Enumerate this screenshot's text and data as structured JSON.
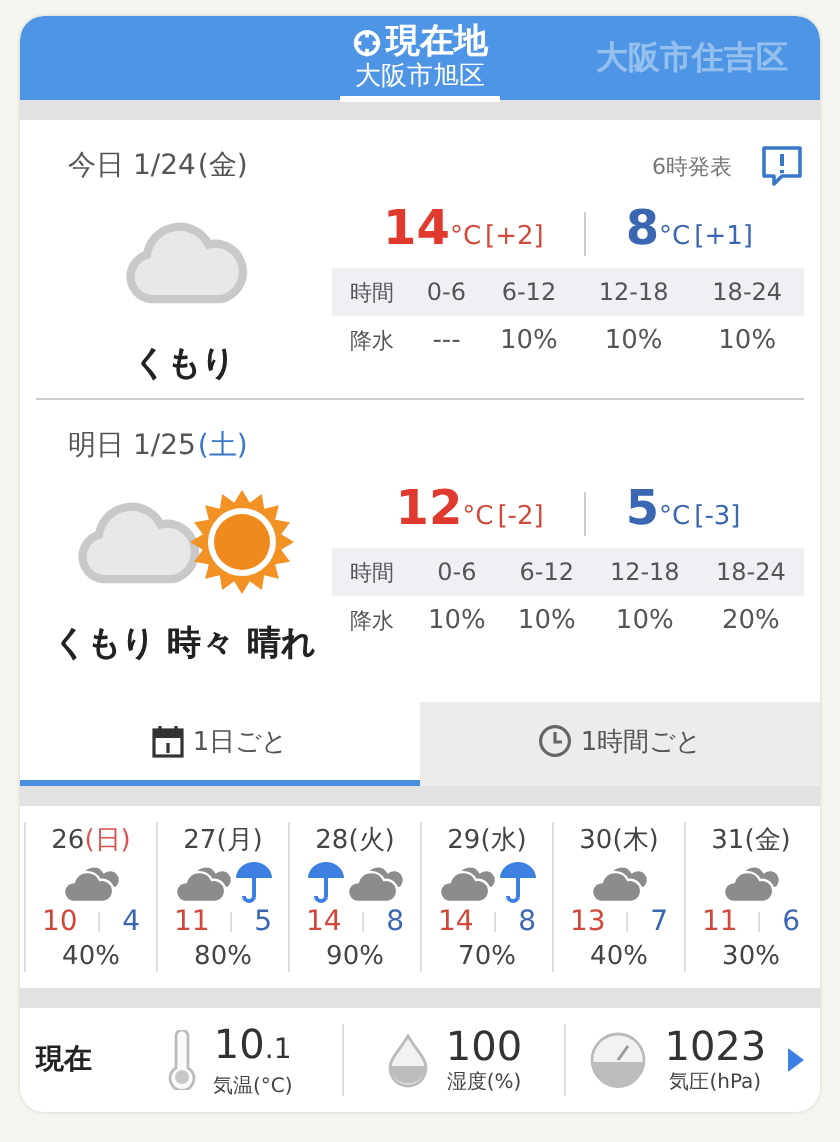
{
  "locations": [
    {
      "name": "現在地",
      "area": "大阪市旭区",
      "selected": true,
      "kind": "gps"
    },
    {
      "name": "大阪市住吉区",
      "selected": false,
      "kind": "city"
    }
  ],
  "days": [
    {
      "date": "今日 1/24",
      "weekday": "(金)",
      "color": "#555555",
      "issued": "6時発表",
      "weather": "くもり",
      "kind": "cloud",
      "high": "14",
      "high_unit": "°C",
      "high_diff": "[+2]",
      "low": "8",
      "low_unit": "°C",
      "low_diff": "[+1]",
      "hours": [
        "時間",
        "0-6",
        "6-12",
        "12-18",
        "18-24"
      ],
      "rain": [
        "降水",
        "---",
        "10%",
        "10%",
        "10%"
      ]
    },
    {
      "date": "明日 1/25",
      "weekday": "(土)",
      "color": "#3a78c9",
      "weather": "くもり 時々 晴れ",
      "kind": "cloud_sun",
      "high": "12",
      "high_unit": "°C",
      "high_diff": "[-2]",
      "low": "5",
      "low_unit": "°C",
      "low_diff": "[-3]",
      "hours": [
        "時間",
        "0-6",
        "6-12",
        "12-18",
        "18-24"
      ],
      "rain": [
        "降水",
        "10%",
        "10%",
        "10%",
        "20%"
      ]
    }
  ],
  "mode_tabs": [
    {
      "label": "1日ごと",
      "kind": "calendar",
      "selected": true
    },
    {
      "label": "1時間ごと",
      "kind": "clock",
      "selected": false
    }
  ],
  "week": [
    {
      "date": "26",
      "weekday": "(日)",
      "color": "#d9534f",
      "kind": "cloud",
      "high": "10",
      "low": "4",
      "rain": "40%"
    },
    {
      "date": "27",
      "weekday": "(月)",
      "color": "#444444",
      "kind": "cloud_rain",
      "high": "11",
      "low": "5",
      "rain": "80%"
    },
    {
      "date": "28",
      "weekday": "(火)",
      "color": "#444444",
      "kind": "rain_cloud",
      "high": "14",
      "low": "8",
      "rain": "90%"
    },
    {
      "date": "29",
      "weekday": "(水)",
      "color": "#444444",
      "kind": "cloud_rain",
      "high": "14",
      "low": "8",
      "rain": "70%"
    },
    {
      "date": "30",
      "weekday": "(木)",
      "color": "#444444",
      "kind": "cloud",
      "high": "13",
      "low": "7",
      "rain": "40%"
    },
    {
      "date": "31",
      "weekday": "(金)",
      "color": "#444444",
      "kind": "cloud",
      "high": "11",
      "low": "6",
      "rain": "30%"
    }
  ],
  "now": {
    "label": "現在",
    "readings": [
      {
        "kind": "thermometer",
        "value": "10",
        "fraction": ".1",
        "label": "気温(°C)"
      },
      {
        "kind": "drop",
        "value": "100",
        "label": "湿度(%)"
      },
      {
        "kind": "gauge",
        "value": "1023",
        "label": "気圧(hPa)"
      }
    ]
  }
}
